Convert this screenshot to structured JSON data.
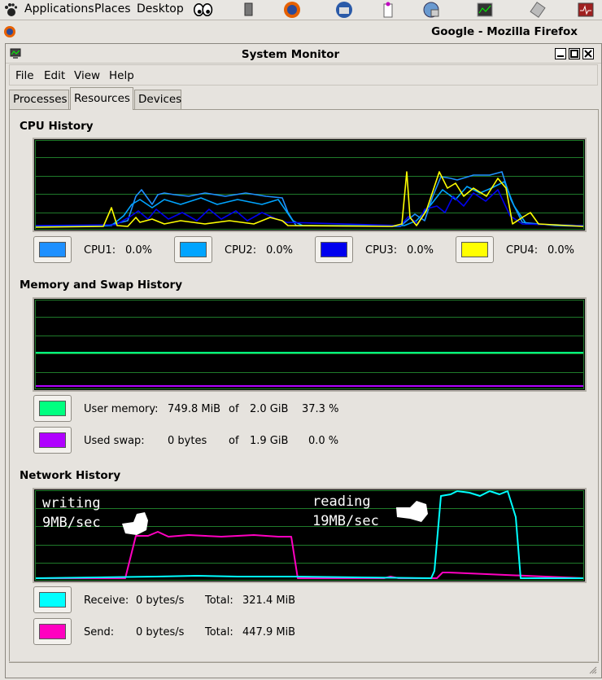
{
  "panel": {
    "menus": [
      "Applications",
      "Places",
      "Desktop"
    ],
    "launchers": [
      "eyes-icon",
      "terminal-icon",
      "firefox-icon",
      "thunderbird-icon",
      "clipboard-icon",
      "network-icon",
      "system-monitor-icon",
      "usb-icon",
      "pulse-icon"
    ]
  },
  "background_window": {
    "title": "Google - Mozilla Firefox"
  },
  "window": {
    "title": "System Monitor",
    "menu": [
      "File",
      "Edit",
      "View",
      "Help"
    ],
    "tabs": [
      "Processes",
      "Resources",
      "Devices"
    ],
    "active_tab": "Resources"
  },
  "cpu": {
    "heading": "CPU History",
    "items": [
      {
        "label": "CPU1:",
        "value": "0.0%",
        "color": "#1e90ff"
      },
      {
        "label": "CPU2:",
        "value": "0.0%",
        "color": "#00a4ff"
      },
      {
        "label": "CPU3:",
        "value": "0.0%",
        "color": "#0000ee"
      },
      {
        "label": "CPU4:",
        "value": "0.0%",
        "color": "#ffff00"
      }
    ]
  },
  "memory": {
    "heading": "Memory and Swap History",
    "user": {
      "label": "User memory:",
      "used": "749.8 MiB",
      "of": "of",
      "total": "2.0 GiB",
      "percent": "37.3 %",
      "color": "#00ff80"
    },
    "swap": {
      "label": "Used swap:",
      "used": "0 bytes",
      "of": "of",
      "total": "1.9 GiB",
      "percent": "0.0 %",
      "color": "#b000ff"
    }
  },
  "network": {
    "heading": "Network History",
    "annotations": {
      "writing": [
        "writing",
        "9MB/sec"
      ],
      "reading": [
        "reading",
        "19MB/sec"
      ]
    },
    "receive": {
      "label": "Receive:",
      "rate": "0 bytes/s",
      "total_label": "Total:",
      "total": "321.4 MiB",
      "color": "#00ffff"
    },
    "send": {
      "label": "Send:",
      "rate": "0 bytes/s",
      "total_label": "Total:",
      "total": "447.9 MiB",
      "color": "#ff00c0"
    }
  }
}
